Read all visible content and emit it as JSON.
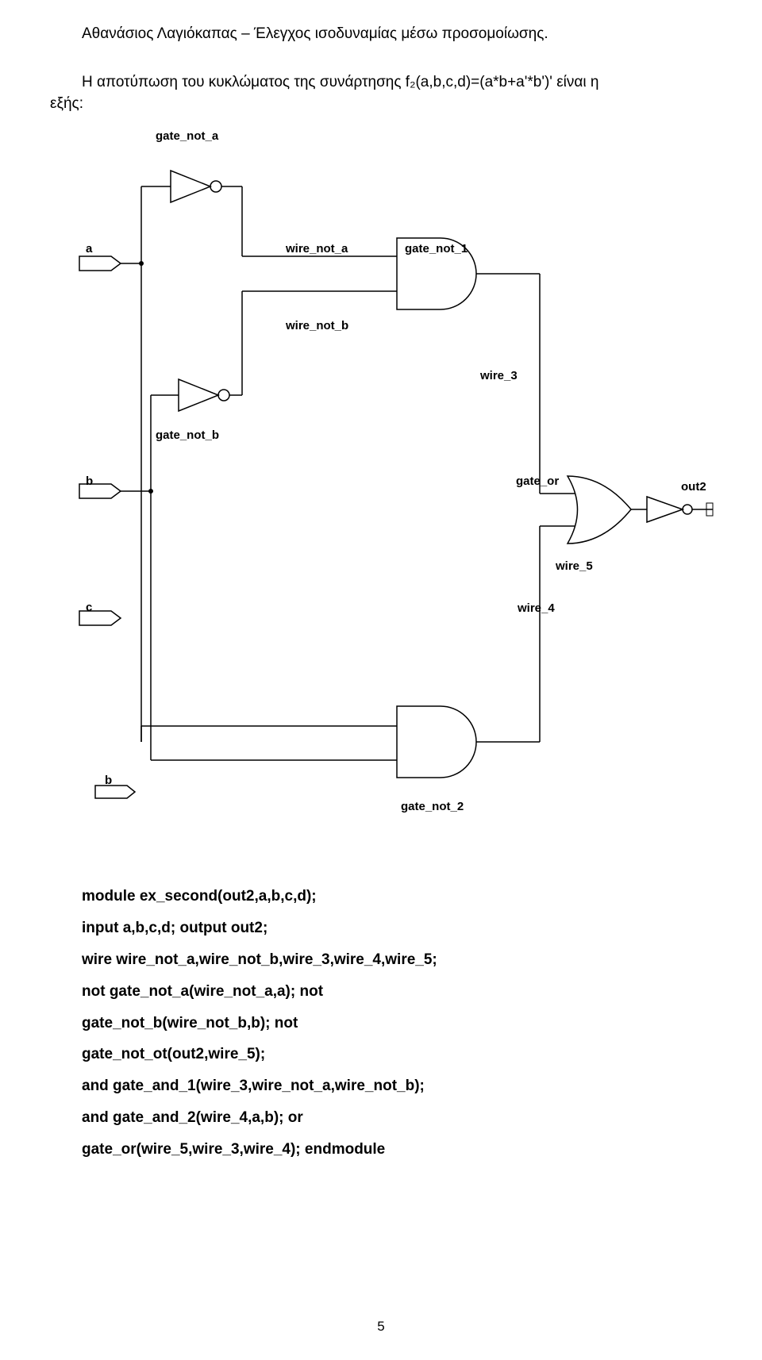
{
  "header": "Αθανάσιος Λαγιόκαπας – Έλεγχος ισοδυναμίας μέσω προσομοίωσης.",
  "intro_line1": "Η αποτύπωση του κυκλώματος της συνάρτησης f₂(a,b,c,d)=(a*b+a'*b')' είναι η",
  "intro_line2": "εξής:",
  "labels": {
    "gate_not_a": "gate_not_a",
    "a": "a",
    "wire_not_a": "wire_not_a",
    "gate_not_1": "gate_not_1",
    "wire_not_b": "wire_not_b",
    "wire_3": "wire_3",
    "gate_not_b": "gate_not_b",
    "b": "b",
    "gate_or": "gate_or",
    "out2": "out2",
    "wire_5": "wire_5",
    "c": "c",
    "wire_4": "wire_4",
    "b2": "b",
    "gate_not_2": "gate_not_2"
  },
  "code": {
    "l1": "module ex_second(out2,a,b,c,d);",
    "l2": "input a,b,c,d; output out2;",
    "l3": "wire wire_not_a,wire_not_b,wire_3,wire_4,wire_5;",
    "l4": "not gate_not_a(wire_not_a,a); not",
    "l5": "gate_not_b(wire_not_b,b); not",
    "l6": "gate_not_ot(out2,wire_5);",
    "l7": "and gate_and_1(wire_3,wire_not_a,wire_not_b);",
    "l8": "and gate_and_2(wire_4,a,b); or",
    "l9": "gate_or(wire_5,wire_3,wire_4); endmodule"
  },
  "page_num": "5"
}
